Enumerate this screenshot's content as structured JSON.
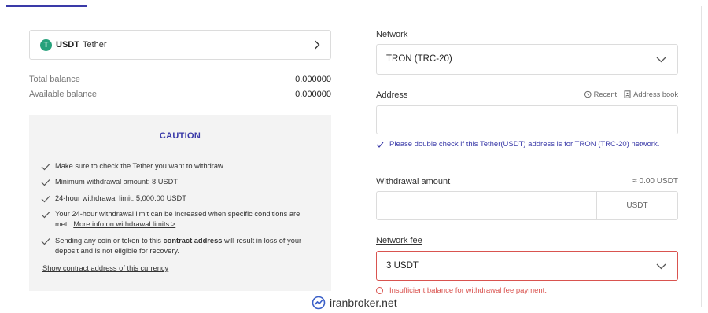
{
  "coin": {
    "symbol": "USDT",
    "name": "Tether",
    "logo_glyph": "T",
    "logo_color": "#26a17b"
  },
  "balances": [
    {
      "label": "Total balance",
      "value": "0.000000"
    },
    {
      "label": "Available balance",
      "value": "0.000000"
    }
  ],
  "caution": {
    "title": "CAUTION",
    "items": [
      {
        "text": "Make sure to check the Tether you want to withdraw"
      },
      {
        "text": "Minimum withdrawal amount: 8 USDT"
      },
      {
        "text": "24-hour withdrawal limit: 5,000.00 USDT"
      },
      {
        "text": "Your 24-hour withdrawal limit can be increased when specific conditions are met.",
        "link": "More info on withdrawal limits >"
      },
      {
        "before": "Sending any coin or token to this ",
        "bold": "contract address",
        "after": " will result in loss of your deposit and is not eligible for recovery."
      }
    ],
    "contract_link": "Show contract address of this currency"
  },
  "network": {
    "label": "Network",
    "value": "TRON (TRC-20)"
  },
  "address": {
    "label": "Address",
    "recent": "Recent",
    "address_book": "Address book",
    "hint": "Please double check if this Tether(USDT) address is for TRON (TRC-20) network."
  },
  "withdrawal": {
    "label": "Withdrawal amount",
    "approx": "≈ 0.00 USDT",
    "unit": "USDT"
  },
  "fee": {
    "label": "Network fee",
    "value": "3 USDT",
    "error": "Insufficient balance for withdrawal fee payment."
  },
  "watermark": "iranbroker.net",
  "colors": {
    "accent": "#3a3aa8",
    "error": "#d9534f",
    "caution_bg": "#f3f3f3"
  }
}
